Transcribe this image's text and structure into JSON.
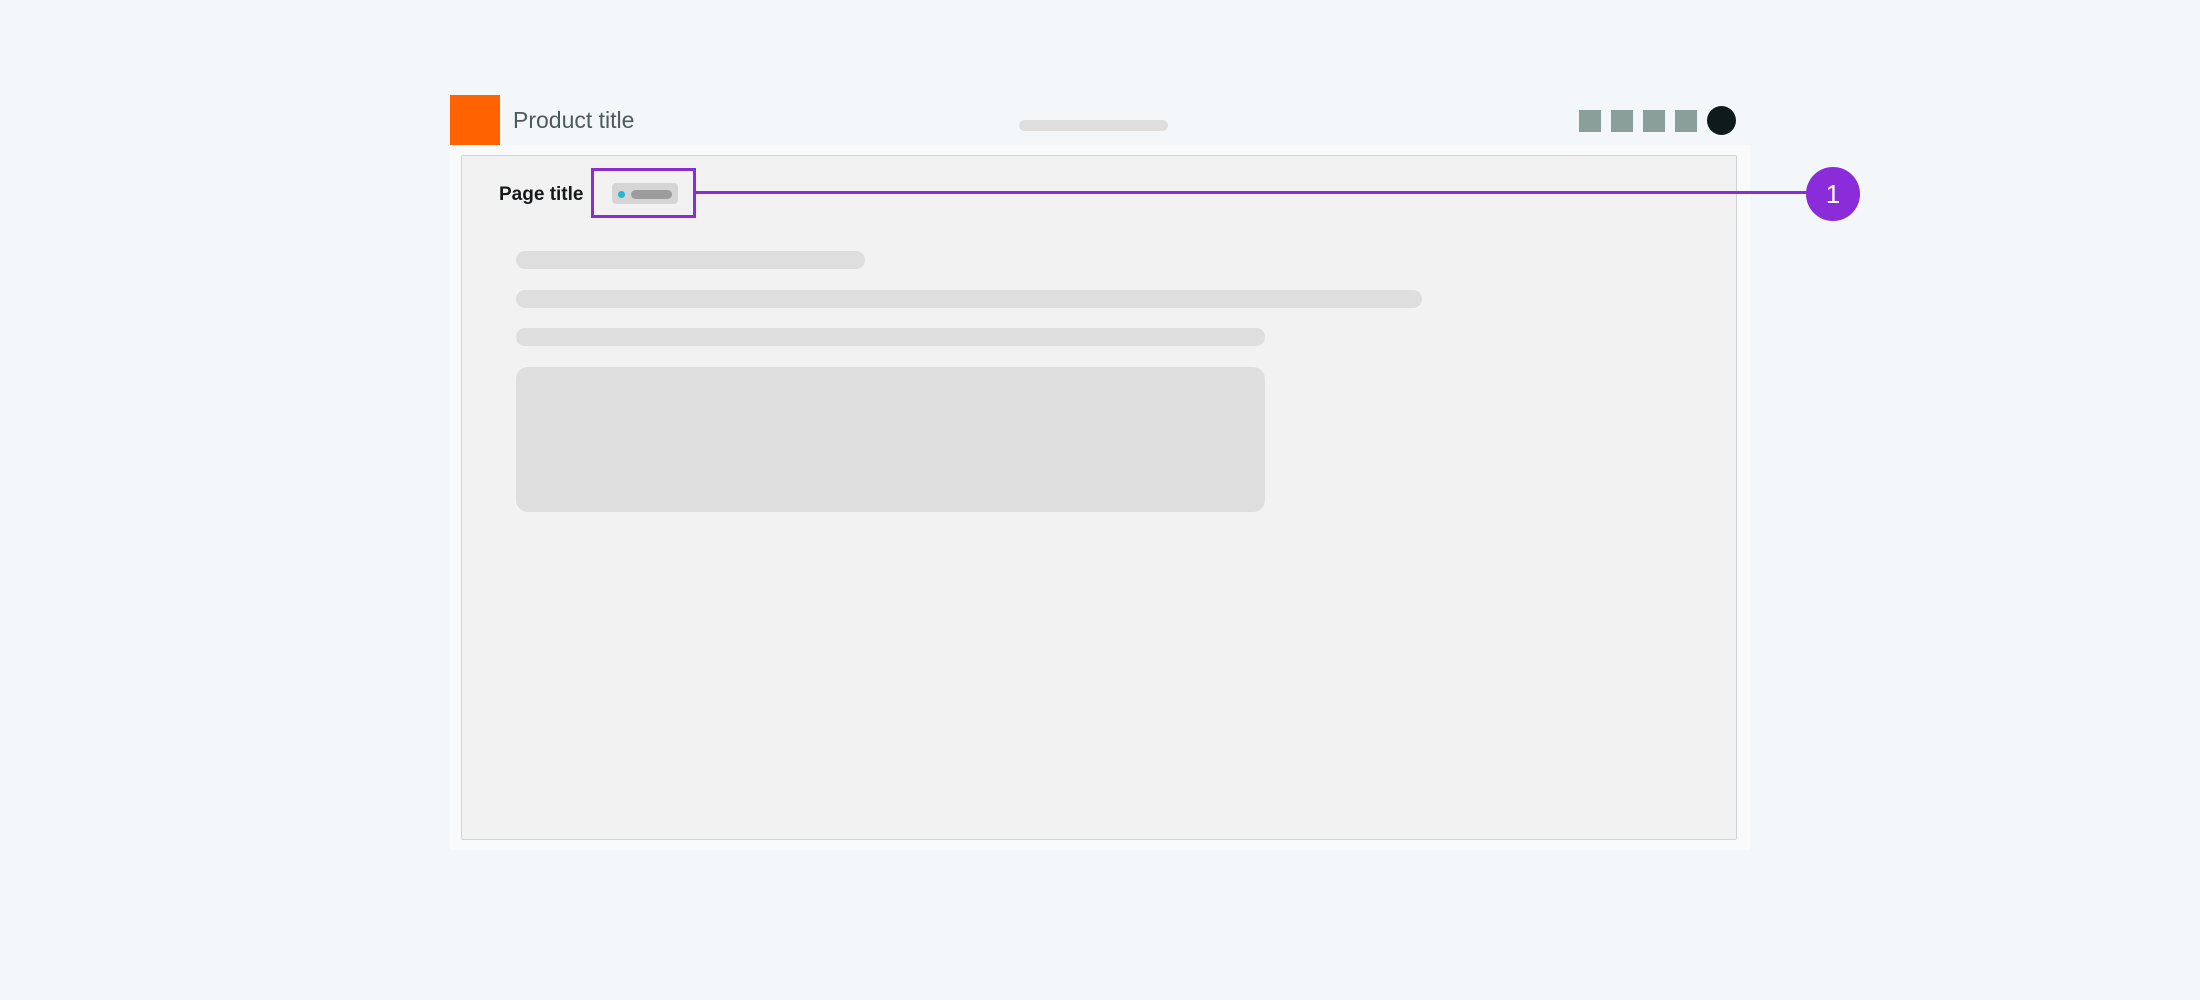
{
  "header": {
    "product_title": "Product title",
    "logo_color": "#ff6200",
    "icons": [
      "header-action-1-icon",
      "header-action-2-icon",
      "header-action-3-icon",
      "header-action-4-icon",
      "user-avatar-icon"
    ]
  },
  "page": {
    "title": "Page title",
    "tag": {
      "dot_color": "#1fb8d4"
    }
  },
  "annotation": {
    "marker": "1",
    "color": "#8a2cd9"
  }
}
